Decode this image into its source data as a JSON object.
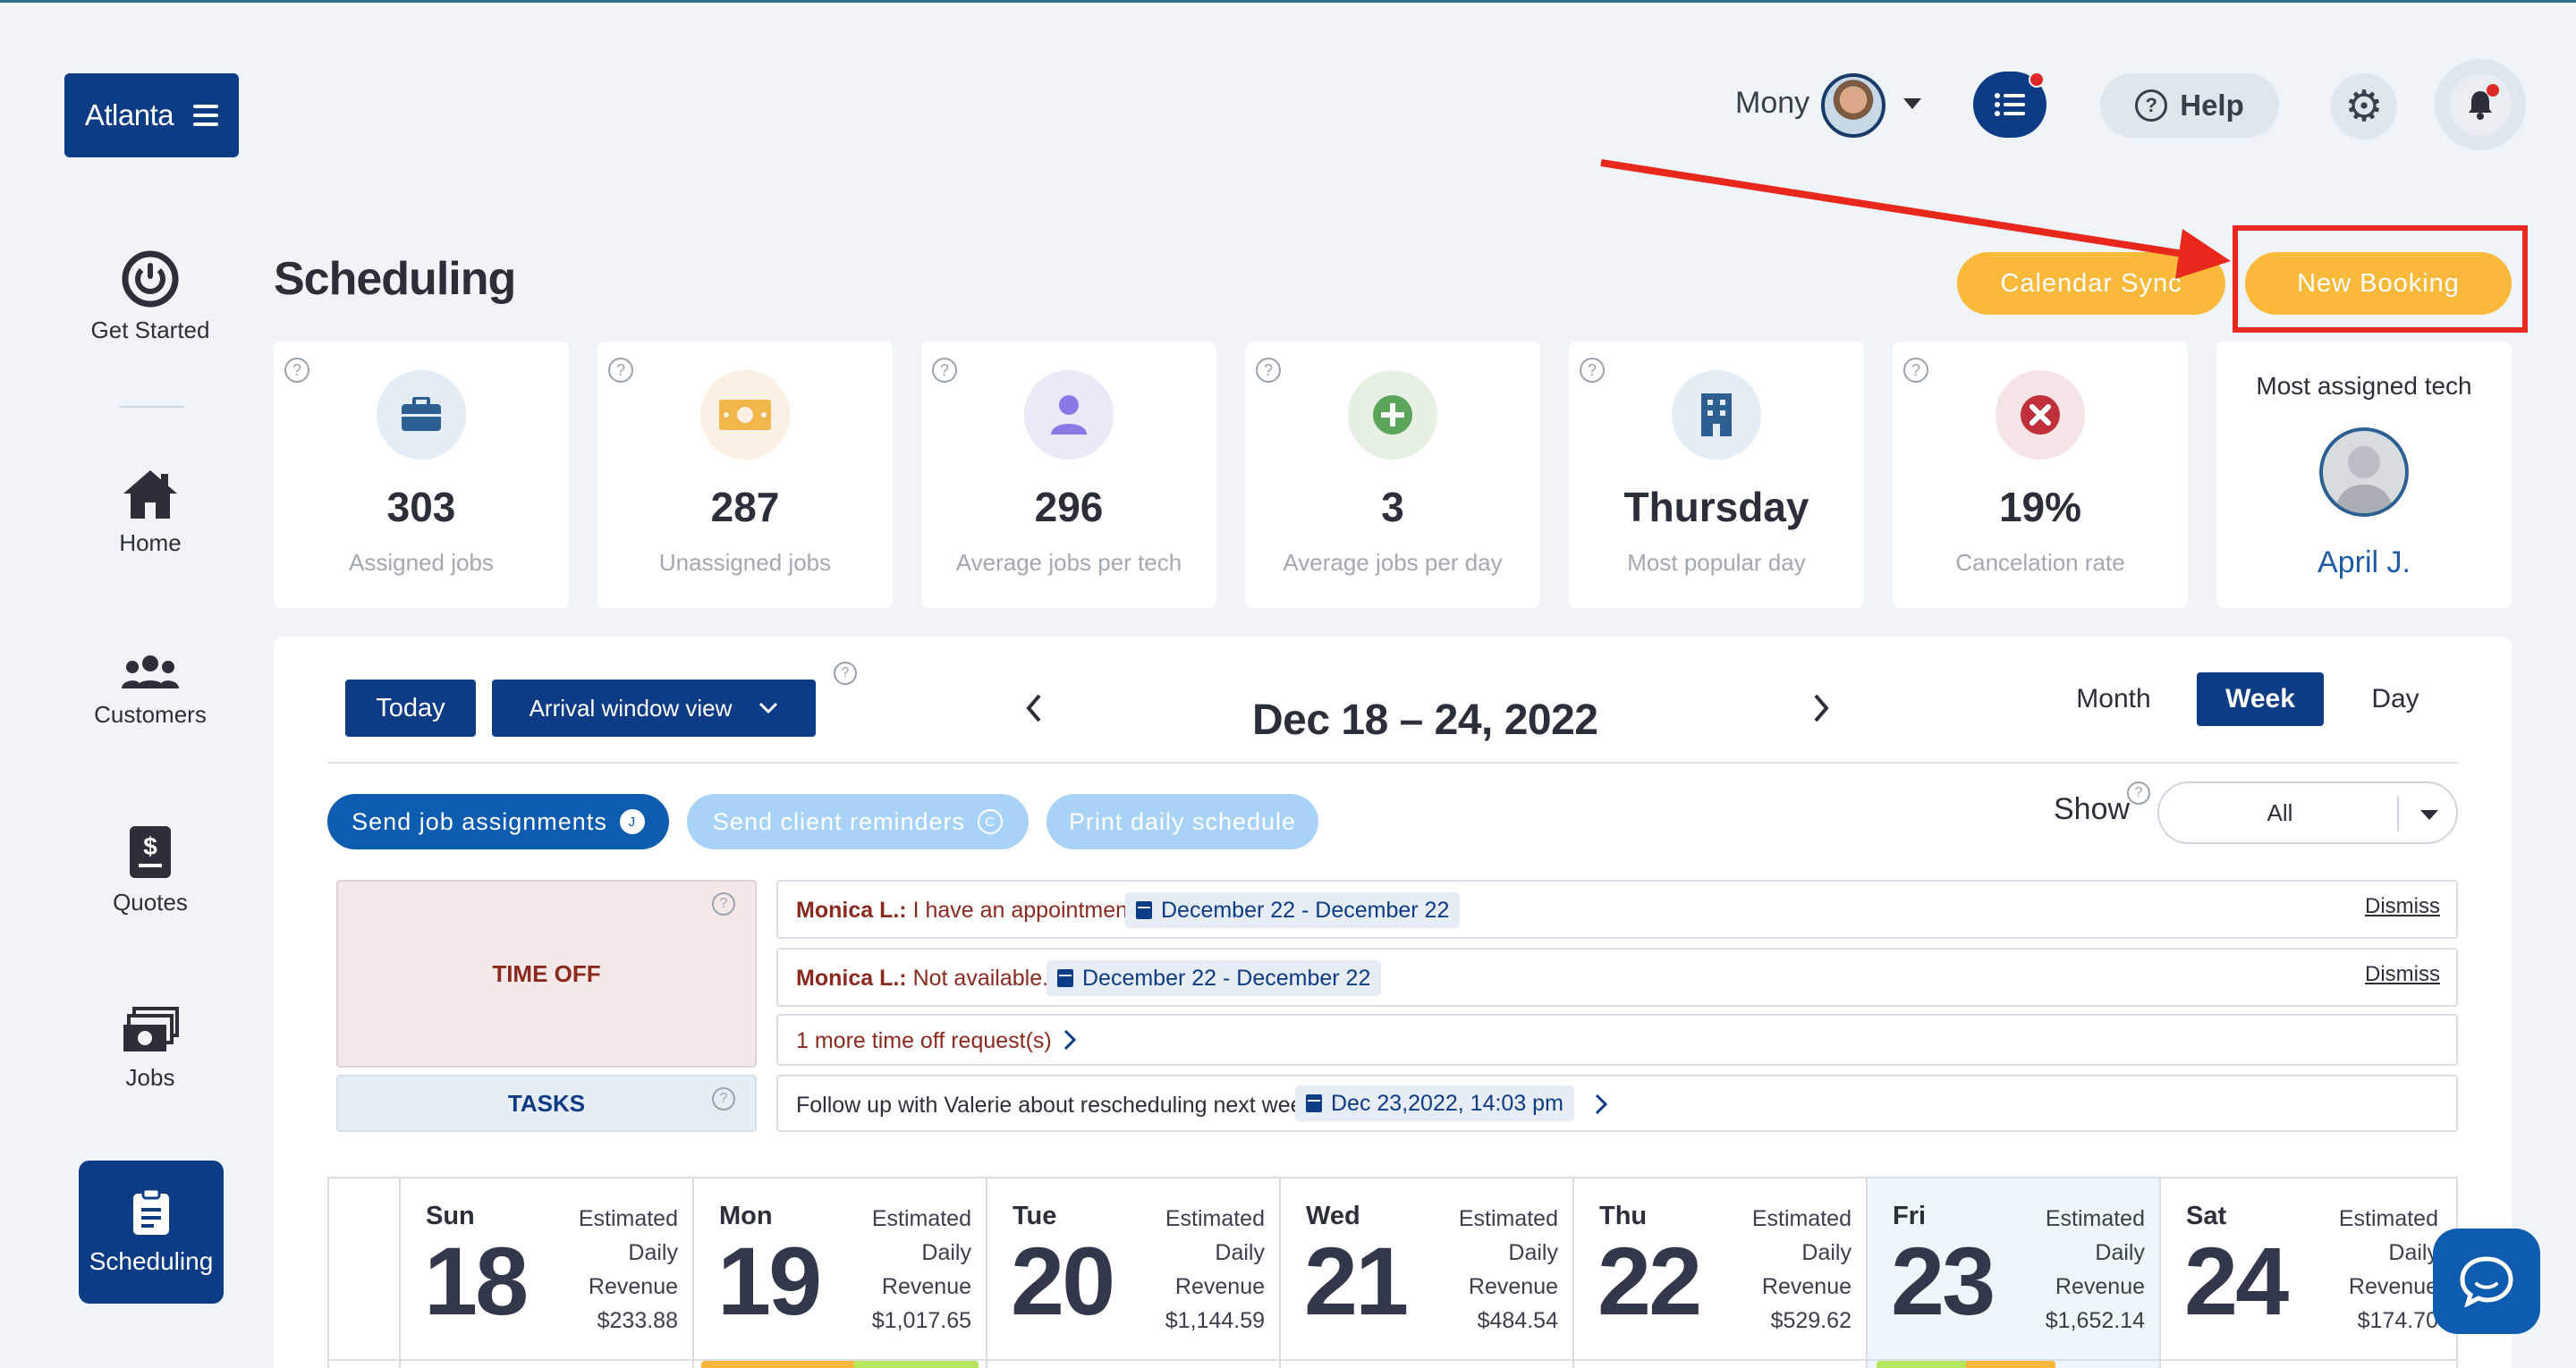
{
  "app": {
    "location_label": "Atlanta",
    "user_name": "Mony",
    "help_label": "Help"
  },
  "sidebar": {
    "items": [
      {
        "label": "Get Started",
        "icon": "power-icon"
      },
      {
        "label": "Home",
        "icon": "home-icon"
      },
      {
        "label": "Customers",
        "icon": "users-icon"
      },
      {
        "label": "Quotes",
        "icon": "dollar-doc-icon"
      },
      {
        "label": "Jobs",
        "icon": "money-stack-icon"
      },
      {
        "label": "Scheduling",
        "icon": "clipboard-icon",
        "active": true
      }
    ]
  },
  "header": {
    "title": "Scheduling",
    "calendar_sync_label": "Calendar Sync",
    "new_booking_label": "New Booking"
  },
  "stats": [
    {
      "value": "303",
      "label": "Assigned jobs",
      "icon": "briefcase-icon",
      "color": "#2d5f91",
      "bg": "#e4ecf4"
    },
    {
      "value": "287",
      "label": "Unassigned jobs",
      "icon": "cash-icon",
      "color": "#f2b54a",
      "bg": "#fbf1e2"
    },
    {
      "value": "296",
      "label": "Average jobs per tech",
      "icon": "person-icon",
      "color": "#8b78e6",
      "bg": "#ebe8f8"
    },
    {
      "value": "3",
      "label": "Average jobs per day",
      "icon": "plus-circle-icon",
      "color": "#5aa55a",
      "bg": "#e6f1e4"
    },
    {
      "value": "Thursday",
      "label": "Most popular day",
      "icon": "building-icon",
      "color": "#2d5f91",
      "bg": "#e4ecf4"
    },
    {
      "value": "19%",
      "label": "Cancelation rate",
      "icon": "x-circle-icon",
      "color": "#c0303a",
      "bg": "#f5e4e4"
    }
  ],
  "most_assigned": {
    "title": "Most assigned tech",
    "name": "April J."
  },
  "toolbar": {
    "today_label": "Today",
    "arrival_view_label": "Arrival window view",
    "date_range": "Dec 18 – 24, 2022",
    "views": [
      "Month",
      "Week",
      "Day"
    ],
    "active_view": "Week"
  },
  "actions": {
    "send_assignments": "Send job assignments",
    "send_assignments_badge": "J",
    "send_reminders": "Send client reminders",
    "send_reminders_badge": "C",
    "print_schedule": "Print daily schedule",
    "show_label": "Show",
    "show_value": "All"
  },
  "time_off": {
    "label": "TIME OFF",
    "requests": [
      {
        "name": "Monica L.:",
        "message": "I have an appointment.",
        "dates": "December 22 - December 22",
        "dismiss": "Dismiss"
      },
      {
        "name": "Monica L.:",
        "message": "Not available.",
        "dates": "December 22 - December 22",
        "dismiss": "Dismiss"
      }
    ],
    "more_link": "1 more time off request(s)"
  },
  "tasks": {
    "label": "TASKS",
    "text": "Follow up with Valerie about rescheduling next week.",
    "date": "Dec 23,2022, 14:03 pm"
  },
  "calendar": {
    "revenue_label": [
      "Estimated",
      "Daily",
      "Revenue"
    ],
    "days": [
      {
        "name": "Sun",
        "num": "18",
        "revenue": "$233.88"
      },
      {
        "name": "Mon",
        "num": "19",
        "revenue": "$1,017.65"
      },
      {
        "name": "Tue",
        "num": "20",
        "revenue": "$1,144.59"
      },
      {
        "name": "Wed",
        "num": "21",
        "revenue": "$484.54"
      },
      {
        "name": "Thu",
        "num": "22",
        "revenue": "$529.62"
      },
      {
        "name": "Fri",
        "num": "23",
        "revenue": "$1,652.14"
      },
      {
        "name": "Sat",
        "num": "24",
        "revenue": "$174.70"
      }
    ]
  },
  "colors": {
    "navy": "#0d3b84",
    "orange": "#f9b93a",
    "annotation_red": "#e8281c"
  }
}
